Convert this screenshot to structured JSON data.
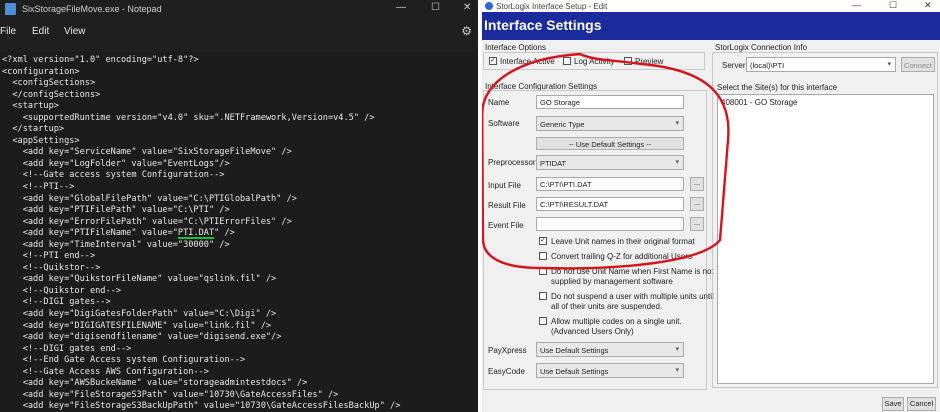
{
  "notepad": {
    "title": "SixStorageFileMove.exe - Notepad",
    "window_controls": {
      "minimize": "—",
      "maximize": "☐",
      "close": "✕"
    },
    "menu": {
      "file": "File",
      "edit": "Edit",
      "view": "View"
    },
    "lines": [
      "<?xml version=\"1.0\" encoding=\"utf-8\"?>",
      "<configuration>",
      "  <configSections>",
      "  </configSections>",
      "  <startup>",
      "    <supportedRuntime version=\"v4.0\" sku=\".NETFramework,Version=v4.5\" />",
      "  </startup>",
      "  <appSettings>",
      "    <add key=\"ServiceName\" value=\"SixStorageFileMove\" />",
      "    <add key=\"LogFolder\" value=\"EventLogs\"/>",
      "    <!--Gate access system Configuration-->",
      "    <!--PTI-->",
      "    <add key=\"GlobalFilePath\" value=\"C:\\PTIGlobalPath\" />",
      "    <add key=\"PTIFilePath\" value=\"C:\\PTI\" />",
      "    <add key=\"ErrorFilePath\" value=\"C:\\PTIErrorFiles\" />",
      "    <add key=\"PTIFileName\" value=\"PTI.DAT\" />",
      "    <add key=\"TimeInterval\" value=\"30000\" />",
      "    <!--PTI end-->",
      "    <!--Quikstor-->",
      "    <add key=\"QuikstorFileName\" value=\"qslink.fil\" />",
      "    <!--Quikstor end-->",
      "    <!--DIGI gates-->",
      "    <add key=\"DigiGatesFolderPath\" value=\"C:\\Digi\" />",
      "    <add key=\"DIGIGATESFILENAME\" value=\"link.fil\" />",
      "    <add key=\"digisendfilename\" value=\"digisend.exe\"/>",
      "    <!--DIGI gates end-->",
      "    <!--End Gate Access system Configuration-->",
      "    <!--Gate Access AWS Configuration-->",
      "    <add key=\"AWSBuckeName\" value=\"storageadmintestdocs\" />",
      "    <add key=\"FileStorageS3Path\" value=\"10730\\GateAccessFiles\" />",
      "    <add key=\"FileStorageS3BackUpPath\" value=\"10730\\GateAccessFilesBackUp\" />"
    ],
    "highlight_line_index": 15,
    "highlight_color": "#16c23a"
  },
  "dialog": {
    "title": "StorLogix Interface Setup - Edit",
    "window_controls": {
      "minimize": "—",
      "maximize": "☐",
      "close": "✕"
    },
    "header": "Interface Settings",
    "header_color": "#1a2b9b",
    "options": {
      "group_label": "Interface Options",
      "interface_active": {
        "label": "Interface Active",
        "checked": true
      },
      "log_activity": {
        "label": "Log Activity",
        "checked": false
      },
      "preview": {
        "label": "Preview",
        "checked": false
      }
    },
    "config": {
      "group_label": "Interface Configuration Settings",
      "name_label": "Name",
      "name_value": "GO Storage",
      "software_label": "Software",
      "software_value": "Generic Type",
      "use_default_button": "-- Use Default Settings --",
      "preprocessor_label": "Preprocessor",
      "preprocessor_value": "PTIDAT",
      "input_file_label": "Input File",
      "input_file_value": "C:\\PTI\\PTI.DAT",
      "result_file_label": "Result File",
      "result_file_value": "C:\\PTI\\RESULT.DAT",
      "event_file_label": "Event File",
      "event_file_value": "",
      "browse_label": "...",
      "leave_unit_names": {
        "label": "Leave Unit names in their original format",
        "checked": true
      },
      "convert_trailing": {
        "label": "Convert trailing Q-Z for additional Users",
        "checked": false
      },
      "no_unit_name_line1": "Do not use Unit Name when First Name is not",
      "no_unit_name_line2": "supplied by management software",
      "no_suspend_line1": "Do not suspend a user with multiple units until",
      "no_suspend_line2": "all of their units are suspended.",
      "allow_multiple_line1": "Allow multiple codes on a single unit.",
      "allow_multiple_line2": "(Advanced Users Only)",
      "payxpress_label": "PayXpress",
      "payxpress_value": "Use Default Settings",
      "easycode_label": "EasyCode",
      "easycode_value": "Use Default Settings"
    },
    "connection": {
      "group_label": "StorLogix Connection Info",
      "server_label": "Server",
      "server_value": "(local)\\PTI",
      "connect_button": "Connect",
      "sites_label": "Select the Site(s) for this interface",
      "sites": [
        "408001 - GO Storage"
      ]
    },
    "save_button": "Save",
    "cancel_button": "Cancel",
    "annotation_color": "#d7141c"
  }
}
